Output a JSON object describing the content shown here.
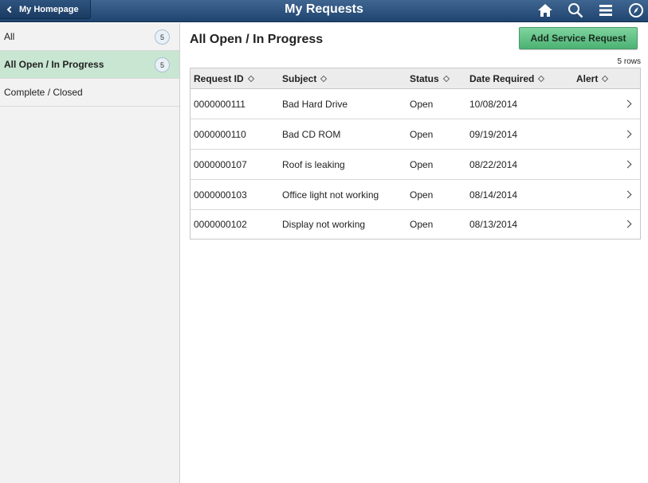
{
  "header": {
    "back_label": "My Homepage",
    "title": "My Requests",
    "icons": [
      "home-icon",
      "search-icon",
      "menu-icon",
      "navbar-icon"
    ]
  },
  "sidebar": {
    "items": [
      {
        "label": "All",
        "count": "5",
        "active": false
      },
      {
        "label": "All Open / In Progress",
        "count": "5",
        "active": true
      },
      {
        "label": "Complete / Closed",
        "count": null,
        "active": false
      }
    ]
  },
  "main": {
    "title": "All Open / In Progress",
    "add_button": "Add Service Request",
    "rows_count": "5 rows",
    "columns": [
      "Request ID",
      "Subject",
      "Status",
      "Date Required",
      "Alert"
    ],
    "rows": [
      {
        "id": "0000000111",
        "subject": "Bad Hard Drive",
        "status": "Open",
        "date": "10/08/2014"
      },
      {
        "id": "0000000110",
        "subject": "Bad CD ROM",
        "status": "Open",
        "date": "09/19/2014"
      },
      {
        "id": "0000000107",
        "subject": "Roof is leaking",
        "status": "Open",
        "date": "08/22/2014"
      },
      {
        "id": "0000000103",
        "subject": "Office light not working",
        "status": "Open",
        "date": "08/14/2014"
      },
      {
        "id": "0000000102",
        "subject": "Display not working",
        "status": "Open",
        "date": "08/13/2014"
      }
    ]
  },
  "colors": {
    "header_bg": "#1f446f",
    "active_item_bg": "#c8e6d2",
    "add_button_bg": "#5cc083"
  }
}
